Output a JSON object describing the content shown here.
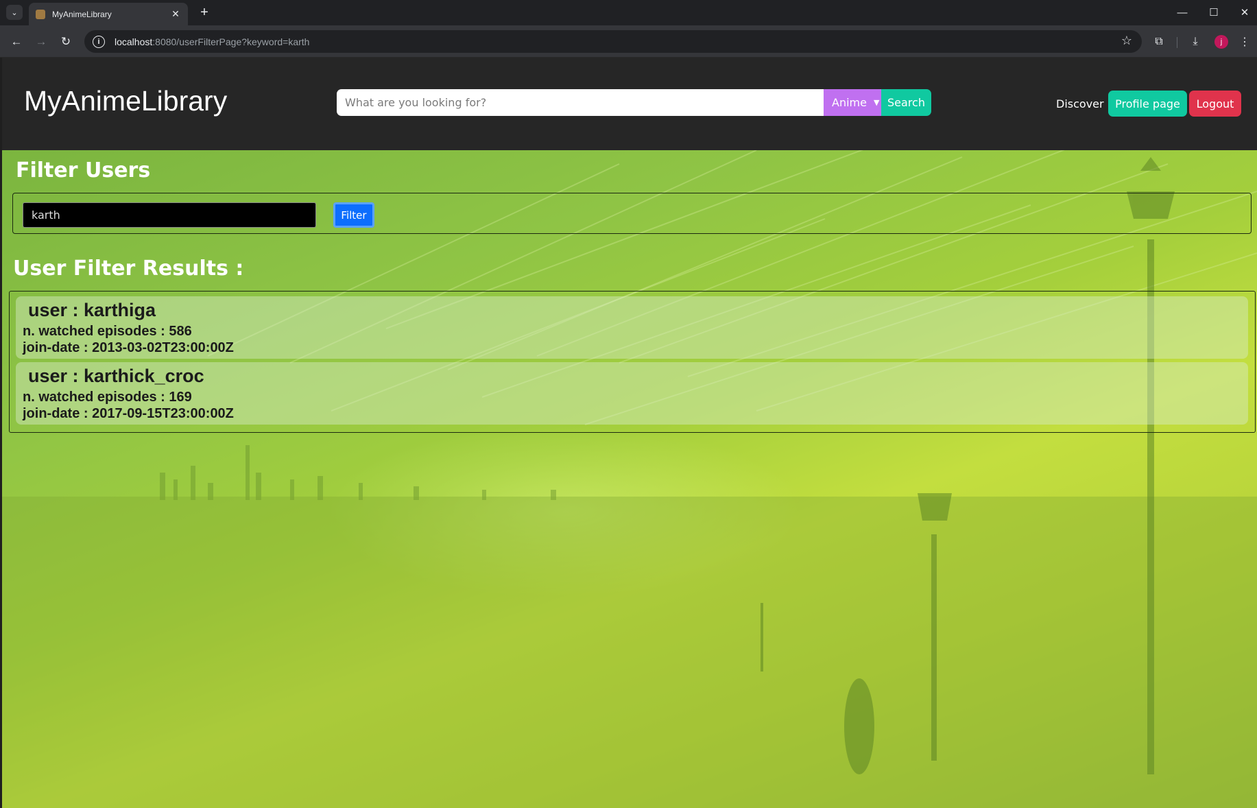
{
  "browser": {
    "tab_title": "MyAnimeLibrary",
    "url_host": "localhost",
    "url_path": ":8080/userFilterPage?keyword=karth",
    "profile_initial": "j"
  },
  "navbar": {
    "brand": "MyAnimeLibrary",
    "search_placeholder": "What are you looking for?",
    "search_type": "Anime",
    "search_button": "Search",
    "discover": "Discover",
    "profile_button": "Profile page",
    "logout_button": "Logout"
  },
  "filter": {
    "heading": "Filter Users",
    "input_value": "karth",
    "button": "Filter"
  },
  "results": {
    "heading": "User Filter Results :",
    "users": [
      {
        "name": "user : karthiga",
        "episodes": "n. watched episodes : 586",
        "join_date": "join-date : 2013-03-02T23:00:00Z"
      },
      {
        "name": "user : karthick_croc",
        "episodes": "n. watched episodes : 169",
        "join_date": "join-date : 2017-09-15T23:00:00Z"
      }
    ]
  },
  "colors": {
    "navbar_bg": "#262626",
    "accent_teal": "#10c9a0",
    "select_purple": "#c070f0",
    "logout_red": "#e0334c",
    "filter_blue": "#0d6efd"
  }
}
